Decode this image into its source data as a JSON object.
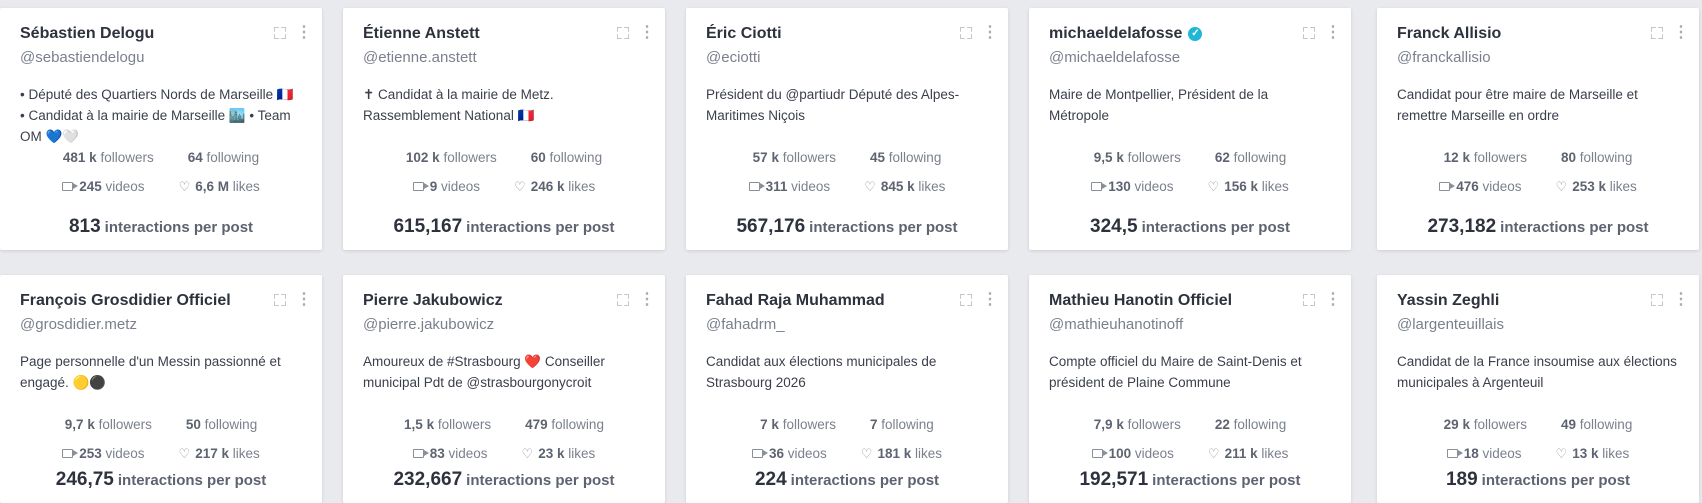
{
  "cards": [
    {
      "name": "Sébastien Delogu",
      "handle": "@sebastiendelogu",
      "bio": "• Député des Quartiers Nords de Marseille 🇫🇷 • Candidat à la mairie de Marseille 🏙️ • Team OM 💙🤍",
      "verified": false,
      "followers": "481 k",
      "following": "64",
      "videos": "245",
      "likes": "6,6 M",
      "ipp": "813"
    },
    {
      "name": "Étienne Anstett",
      "handle": "@etienne.anstett",
      "bio": "✝ Candidat à la mairie de Metz. Rassemblement National 🇫🇷",
      "verified": false,
      "followers": "102 k",
      "following": "60",
      "videos": "9",
      "likes": "246 k",
      "ipp": "615,167"
    },
    {
      "name": "Éric Ciotti",
      "handle": "@eciotti",
      "bio": "Président du @partiudr Député des Alpes-Maritimes Niçois",
      "verified": false,
      "followers": "57 k",
      "following": "45",
      "videos": "311",
      "likes": "845 k",
      "ipp": "567,176"
    },
    {
      "name": "michaeldelafosse",
      "handle": "@michaeldelafosse",
      "bio": "Maire de Montpellier, Président de la Métropole",
      "verified": true,
      "followers": "9,5 k",
      "following": "62",
      "videos": "130",
      "likes": "156 k",
      "ipp": "324,5"
    },
    {
      "name": "Franck Allisio",
      "handle": "@franckallisio",
      "bio": "Candidat pour être maire de Marseille et remettre Marseille en ordre",
      "verified": false,
      "followers": "12 k",
      "following": "80",
      "videos": "476",
      "likes": "253 k",
      "ipp": "273,182"
    },
    {
      "name": "François Grosdidier Officiel",
      "handle": "@grosdidier.metz",
      "bio": "Page personnelle d'un Messin passionné et engagé. 🟡⚫",
      "verified": false,
      "followers": "9,7 k",
      "following": "50",
      "videos": "253",
      "likes": "217 k",
      "ipp": "246,75"
    },
    {
      "name": "Pierre Jakubowicz",
      "handle": "@pierre.jakubowicz",
      "bio": "Amoureux de #Strasbourg ❤️ Conseiller municipal Pdt de @strasbourgonycroit",
      "verified": false,
      "followers": "1,5 k",
      "following": "479",
      "videos": "83",
      "likes": "23 k",
      "ipp": "232,667"
    },
    {
      "name": "Fahad Raja Muhammad",
      "handle": "@fahadrm_",
      "bio": "Candidat aux élections municipales de Strasbourg 2026",
      "verified": false,
      "followers": "7 k",
      "following": "7",
      "videos": "36",
      "likes": "181 k",
      "ipp": "224"
    },
    {
      "name": "Mathieu Hanotin Officiel",
      "handle": "@mathieuhanotinoff",
      "bio": "Compte officiel du Maire de Saint-Denis et président de Plaine Commune",
      "verified": false,
      "followers": "7,9 k",
      "following": "22",
      "videos": "100",
      "likes": "211 k",
      "ipp": "192,571"
    },
    {
      "name": "Yassin Zeghli",
      "handle": "@largenteuillais",
      "bio": "Candidat de la France insoumise aux élections municipales à Argenteuil",
      "verified": false,
      "followers": "29 k",
      "following": "49",
      "videos": "18",
      "likes": "13 k",
      "ipp": "189"
    }
  ],
  "labels": {
    "followers": "followers",
    "following": "following",
    "videos": "videos",
    "likes": "likes",
    "ipp": "interactions per post",
    "verified_mark": "✓"
  },
  "icons": {
    "expand": "expand-icon",
    "more": "more-vertical-icon",
    "video": "video-camera-icon",
    "heart": "heart-icon"
  },
  "colors": {
    "background": "#e9eaee",
    "card": "#ffffff",
    "verified": "#20b7d4"
  }
}
